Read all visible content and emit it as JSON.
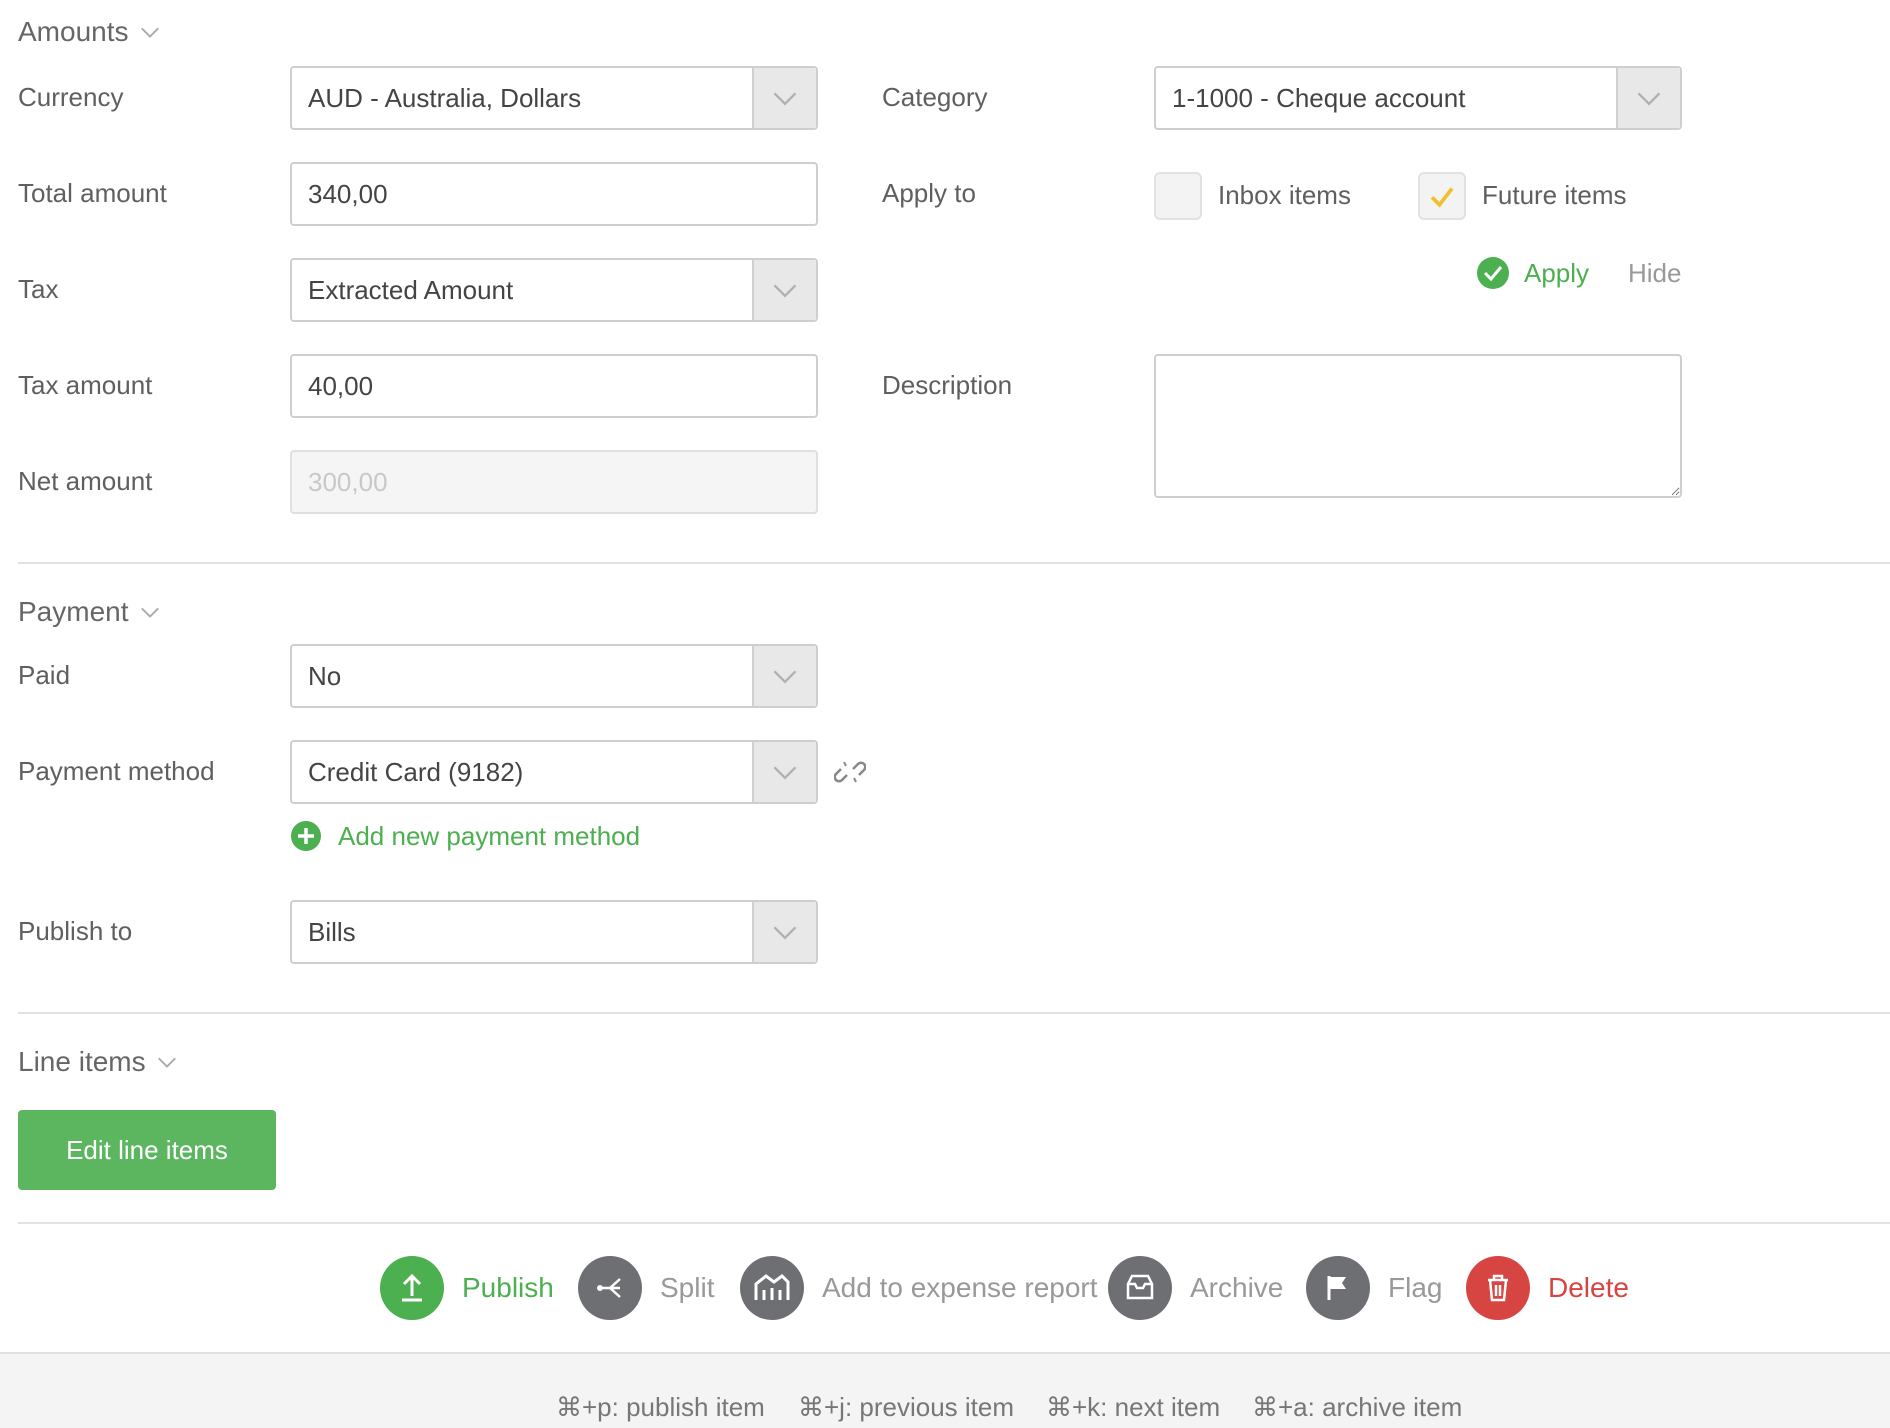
{
  "amounts": {
    "title": "Amounts",
    "currency_label": "Currency",
    "currency_value": "AUD - Australia, Dollars",
    "total_label": "Total amount",
    "total_value": "340,00",
    "tax_label": "Tax",
    "tax_value": "Extracted Amount",
    "tax_amount_label": "Tax amount",
    "tax_amount_value": "40,00",
    "net_label": "Net amount",
    "net_value": "300,00",
    "category_label": "Category",
    "category_value": "1-1000 - Cheque account",
    "apply_to_label": "Apply to",
    "inbox_items_label": "Inbox items",
    "inbox_items_checked": false,
    "future_items_label": "Future items",
    "future_items_checked": true,
    "apply_label": "Apply",
    "hide_label": "Hide",
    "description_label": "Description",
    "description_value": ""
  },
  "payment": {
    "title": "Payment",
    "paid_label": "Paid",
    "paid_value": "No",
    "method_label": "Payment method",
    "method_value": "Credit Card (9182)",
    "add_method_label": "Add new payment method",
    "publish_to_label": "Publish to",
    "publish_to_value": "Bills"
  },
  "line_items": {
    "title": "Line items",
    "edit_button": "Edit line items"
  },
  "actions": {
    "publish": "Publish",
    "split": "Split",
    "expense": "Add to expense report",
    "archive": "Archive",
    "flag": "Flag",
    "delete": "Delete"
  },
  "shortcuts": [
    "⌘+p: publish item",
    "⌘+j: previous item",
    "⌘+k: next item",
    "⌘+a: archive item"
  ],
  "colors": {
    "green": "#4caf50",
    "red": "#d64541",
    "grey_icon": "#6d6f73",
    "check_yellow": "#f0c030"
  }
}
